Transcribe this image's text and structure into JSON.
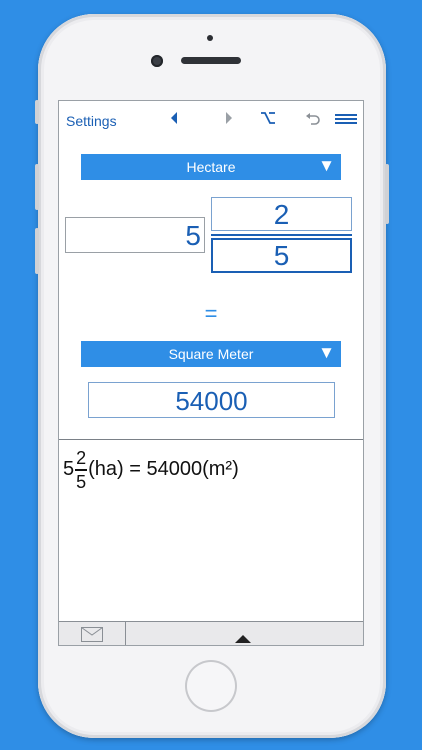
{
  "toolbar": {
    "settings_label": "Settings",
    "icons": [
      "left-arrow-icon",
      "right-arrow-icon",
      "option-icon",
      "undo-icon",
      "menu-icon"
    ]
  },
  "from_unit": {
    "label": "Hectare",
    "arrow": "▼"
  },
  "input": {
    "whole": "5",
    "numerator": "2",
    "denominator": "5"
  },
  "equals": "=",
  "to_unit": {
    "label": "Square Meter",
    "arrow": "▼"
  },
  "result": {
    "value": "54000"
  },
  "formula": {
    "whole": "5",
    "numerator": "2",
    "denominator": "5",
    "rest": "(ha) = 54000(m²)"
  },
  "colors": {
    "accent": "#2f8ee6",
    "text_blue": "#1a5fb4",
    "background": "#2f8ee6"
  }
}
